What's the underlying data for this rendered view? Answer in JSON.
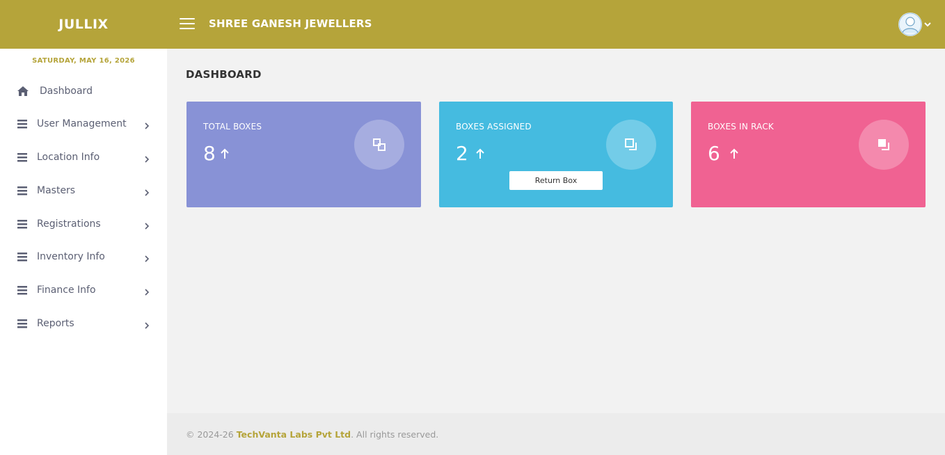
{
  "header": {
    "brand": "JULLIX",
    "company": "SHREE GANESH JEWELLERS",
    "menu_icon": "hamburger-icon",
    "avatar_icon": "user-avatar-icon"
  },
  "sidebar": {
    "date": "SATURDAY, MAY 16, 2026",
    "items": [
      {
        "label": "Dashboard",
        "icon": "home-icon"
      },
      {
        "label": "User Management",
        "icon": "menu-bars-icon"
      },
      {
        "label": "Location Info",
        "icon": "menu-bars-icon"
      },
      {
        "label": "Masters",
        "icon": "menu-bars-icon"
      },
      {
        "label": "Registrations",
        "icon": "menu-bars-icon"
      },
      {
        "label": "Inventory Info",
        "icon": "menu-bars-icon"
      },
      {
        "label": "Finance Info",
        "icon": "menu-bars-icon"
      },
      {
        "label": "Reports",
        "icon": "menu-bars-icon"
      }
    ]
  },
  "main": {
    "title": "DASHBOARD",
    "cards": [
      {
        "title": "TOTAL BOXES",
        "value": "8",
        "color": "#8892d6"
      },
      {
        "title": "BOXES ASSIGNED",
        "value": "2",
        "color": "#45bbe0",
        "button": "Return Box"
      },
      {
        "title": "BOXES IN RACK",
        "value": "6",
        "color": "#f06292"
      }
    ]
  },
  "footer": {
    "prefix": "© 2024-26 ",
    "company": "TechVanta Labs Pvt Ltd",
    "suffix": ". All rights reserved."
  },
  "colors": {
    "brand": "#b5a43a",
    "sidebar_text": "#5b5f73"
  }
}
